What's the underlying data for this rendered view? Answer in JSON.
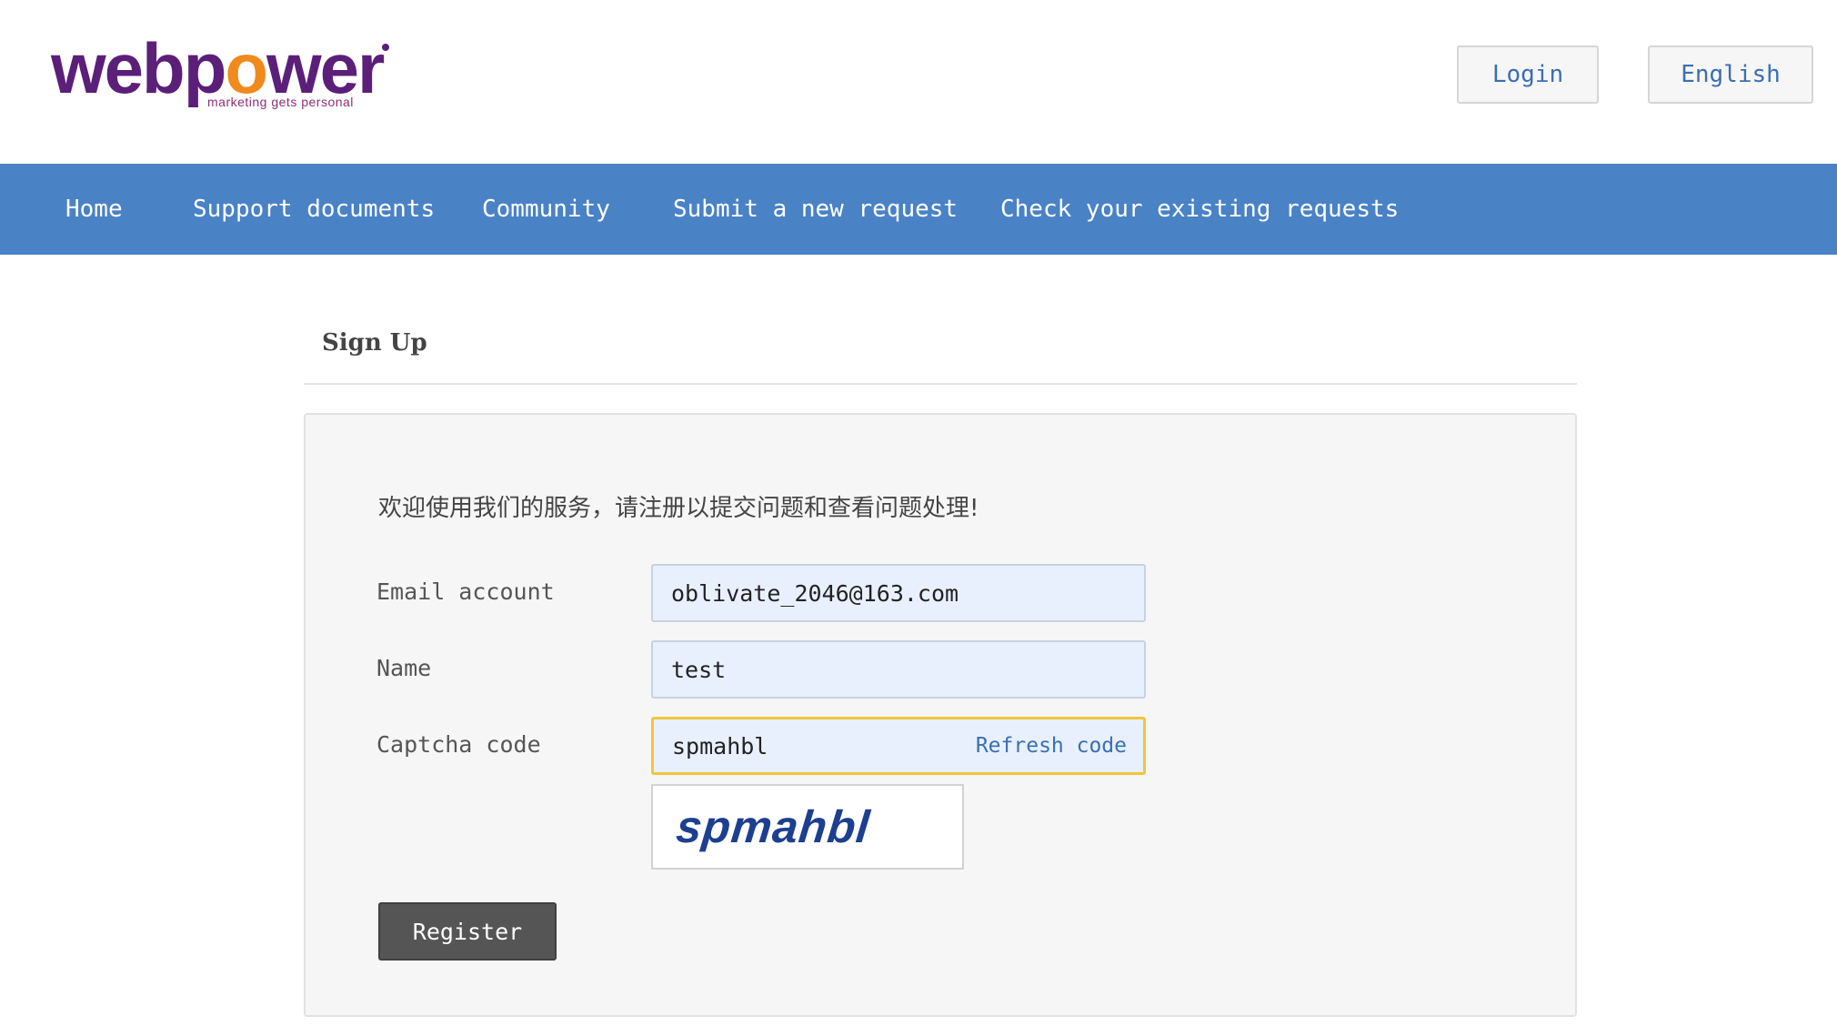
{
  "brand": {
    "logo_text_1": "webp",
    "logo_text_o": "o",
    "logo_text_2": "wer",
    "tagline": "marketing gets personal",
    "primary_color": "#5b1f7a",
    "accent_color": "#f08a1c"
  },
  "header": {
    "login_label": "Login",
    "language_label": "English"
  },
  "nav": {
    "bg_color": "#4a82c6",
    "items": [
      {
        "label": "Home"
      },
      {
        "label": "Support documents"
      },
      {
        "label": "Community"
      },
      {
        "label": "Submit a new request"
      },
      {
        "label": "Check your existing requests"
      }
    ]
  },
  "page": {
    "title": "Sign Up"
  },
  "form": {
    "welcome": "欢迎使用我们的服务，请注册以提交问题和查看问题处理!",
    "email": {
      "label": "Email account",
      "value": "oblivate_2046@163.com"
    },
    "name": {
      "label": "Name",
      "value": "test"
    },
    "captcha": {
      "label": "Captcha code",
      "value": "spmahbl",
      "refresh_label": "Refresh code",
      "image_text": "spmahbl"
    },
    "register_label": "Register"
  }
}
